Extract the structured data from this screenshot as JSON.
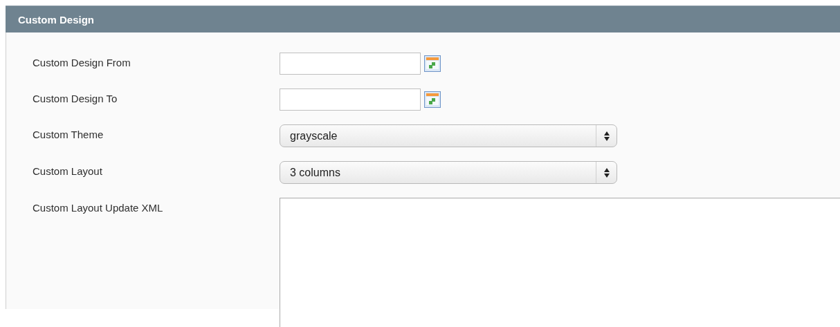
{
  "section": {
    "title": "Custom Design"
  },
  "fields": [
    {
      "kind": "date",
      "label": "Custom Design From"
    },
    {
      "kind": "date",
      "label": "Custom Design To"
    },
    {
      "kind": "select",
      "label": "Custom Theme",
      "value": "grayscale"
    },
    {
      "kind": "select",
      "label": "Custom Layout",
      "value": "3 columns"
    },
    {
      "kind": "textarea",
      "label": "Custom Layout Update XML"
    }
  ]
}
